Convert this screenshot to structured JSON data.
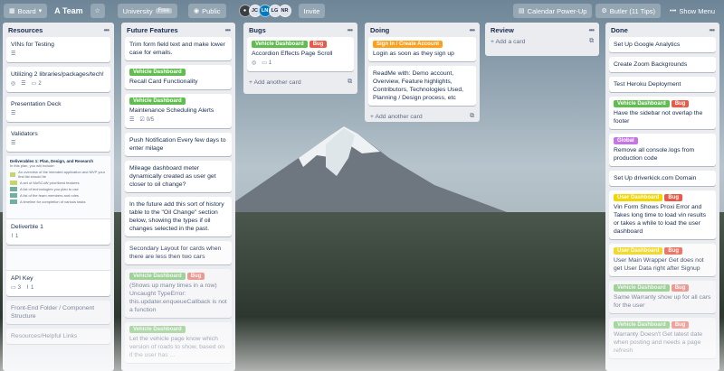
{
  "topbar": {
    "board_label": "Board",
    "board_title": "A Team",
    "team_name": "University",
    "team_badge": "Free",
    "visibility": "Public",
    "members": [
      "JC",
      "LN",
      "LG",
      "NR"
    ],
    "invite_label": "Invite",
    "calendar_label": "Calendar Power-Up",
    "butler_label": "Butler (11 Tips)",
    "show_menu_label": "Show Menu"
  },
  "colors": {
    "green": "#61bd4f",
    "red": "#eb5a46",
    "orange": "#ff9f1a",
    "yellow": "#f2d600",
    "purple": "#c377e0"
  },
  "lists": {
    "resources": {
      "title": "Resources",
      "cards": [
        {
          "title": "VINs for Testing"
        },
        {
          "title": "Utilizing 2 libraries/packages/tech!",
          "comments": "2"
        },
        {
          "title": "Presentation Deck"
        },
        {
          "title": "Validators"
        },
        {
          "title": "Deliverble 1",
          "attachments": "1"
        },
        {
          "title": "API Key",
          "comments": "3",
          "attachments": "1"
        },
        {
          "title": "Front-End Folder / Component Structure"
        },
        {
          "title": "Resources/Helpful Links"
        }
      ],
      "deliverable_preview": {
        "heading": "Deliverables 1: Plan, Design, and Research",
        "intro": "In this plan, you will include:",
        "lines": [
          "An overview of the intended application and MVP your first list should be",
          "A set of MoSCoW prioritized features",
          "A list of technologies you plan to use",
          "A list of the team members and roles",
          "A timeline for completion of various tasks"
        ]
      }
    },
    "future": {
      "title": "Future Features",
      "cards": [
        {
          "title": "Trim form field text and make lower case for emails."
        },
        {
          "label": "Vehicle Dashboard",
          "title": "Recall Card Functionality"
        },
        {
          "label": "Vehicle Dashboard",
          "title": "Maintenance Scheduling Alerts",
          "checklist": "0/5"
        },
        {
          "title": "Push Notification Every few days to enter milage"
        },
        {
          "title": "Mileage dashboard meter dynamically created as user get closer to oil change?"
        },
        {
          "title": "In the future add this sort of history table to the \"Oil Change\" section below, showing the types if oil changes selected in the past."
        },
        {
          "title": "Secondary Layout for cards when there are less then two cars"
        },
        {
          "label": "Vehicle Dashboard",
          "label2": "Bug",
          "title": "(Shows up many times in a row) Uncaught TypeError: this.updater.enqueueCallback is not a function"
        },
        {
          "label": "Vehicle Dashboard",
          "title": "Let the vehicle page know which version of roads to show, based on if the user has ..."
        }
      ]
    },
    "bugs": {
      "title": "Bugs",
      "cards": [
        {
          "label": "Vehicle Dashboard",
          "label2": "Bug",
          "title": "Accordion Effects Page Scroll",
          "comments": "1"
        }
      ],
      "add_label": "Add another card"
    },
    "doing": {
      "title": "Doing",
      "cards": [
        {
          "label": "Sign In / Create Account",
          "title": "Login as soon as they sign up"
        },
        {
          "title": "ReadMe with: Demo account, Overview, Feature highlights, Contributors, Technologies Used, Planning / Design process, etc"
        }
      ],
      "add_label": "Add another card"
    },
    "review": {
      "title": "Review",
      "add_label": "Add a card"
    },
    "done": {
      "title": "Done",
      "cards": [
        {
          "title": "Set Up Google Analytics"
        },
        {
          "title": "Create Zoom Backgrounds"
        },
        {
          "title": "Test Heroku Deployment"
        },
        {
          "label": "Vehicle Dashboard",
          "label2": "Bug",
          "title": "Have the sidebar not overlap the footer"
        },
        {
          "label": "Global",
          "title": "Remove all console.logs from production code"
        },
        {
          "title": "Set Up driverkick.com Domain"
        },
        {
          "label": "User Dashboard",
          "label2": "Bug",
          "title": "Vin Form Shows Proxi Error and Takes long time to load vin results or takes a while to load the user dashboard"
        },
        {
          "label": "User Dashboard",
          "label2": "Bug",
          "title": "User Main Wrapper Get does not get User Data right after Signup"
        },
        {
          "label": "Vehicle Dashboard",
          "label2": "Bug",
          "title": "Same Warranty show up for all cars for the user"
        },
        {
          "label": "Vehicle Dashboard",
          "label2": "Bug",
          "title": "Warranty Doesn't Get latest date when posting and needs a page refresh"
        }
      ]
    }
  }
}
